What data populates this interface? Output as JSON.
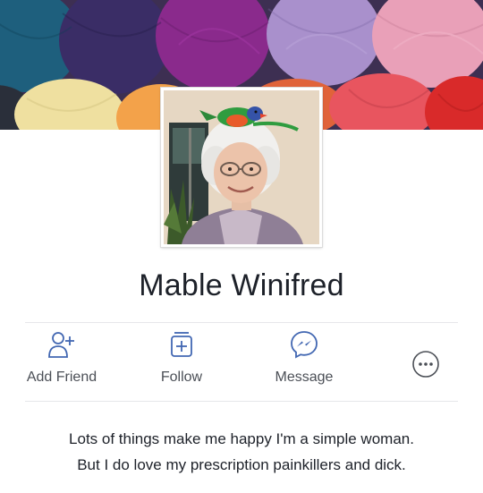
{
  "profile": {
    "name": "Mable Winifred"
  },
  "actions": {
    "add_friend": {
      "label": "Add Friend",
      "icon": "add-friend-icon"
    },
    "follow": {
      "label": "Follow",
      "icon": "follow-icon"
    },
    "message": {
      "label": "Message",
      "icon": "messenger-icon"
    },
    "more": {
      "icon": "more-options-icon"
    }
  },
  "bio": {
    "line1": "Lots of things make me happy I'm a simple woman.",
    "line2": "But I do love my prescription painkillers and dick."
  },
  "colors": {
    "icon_blue": "#4267b2",
    "text_dark": "#1d2129",
    "text_gray": "#4b4f56"
  }
}
